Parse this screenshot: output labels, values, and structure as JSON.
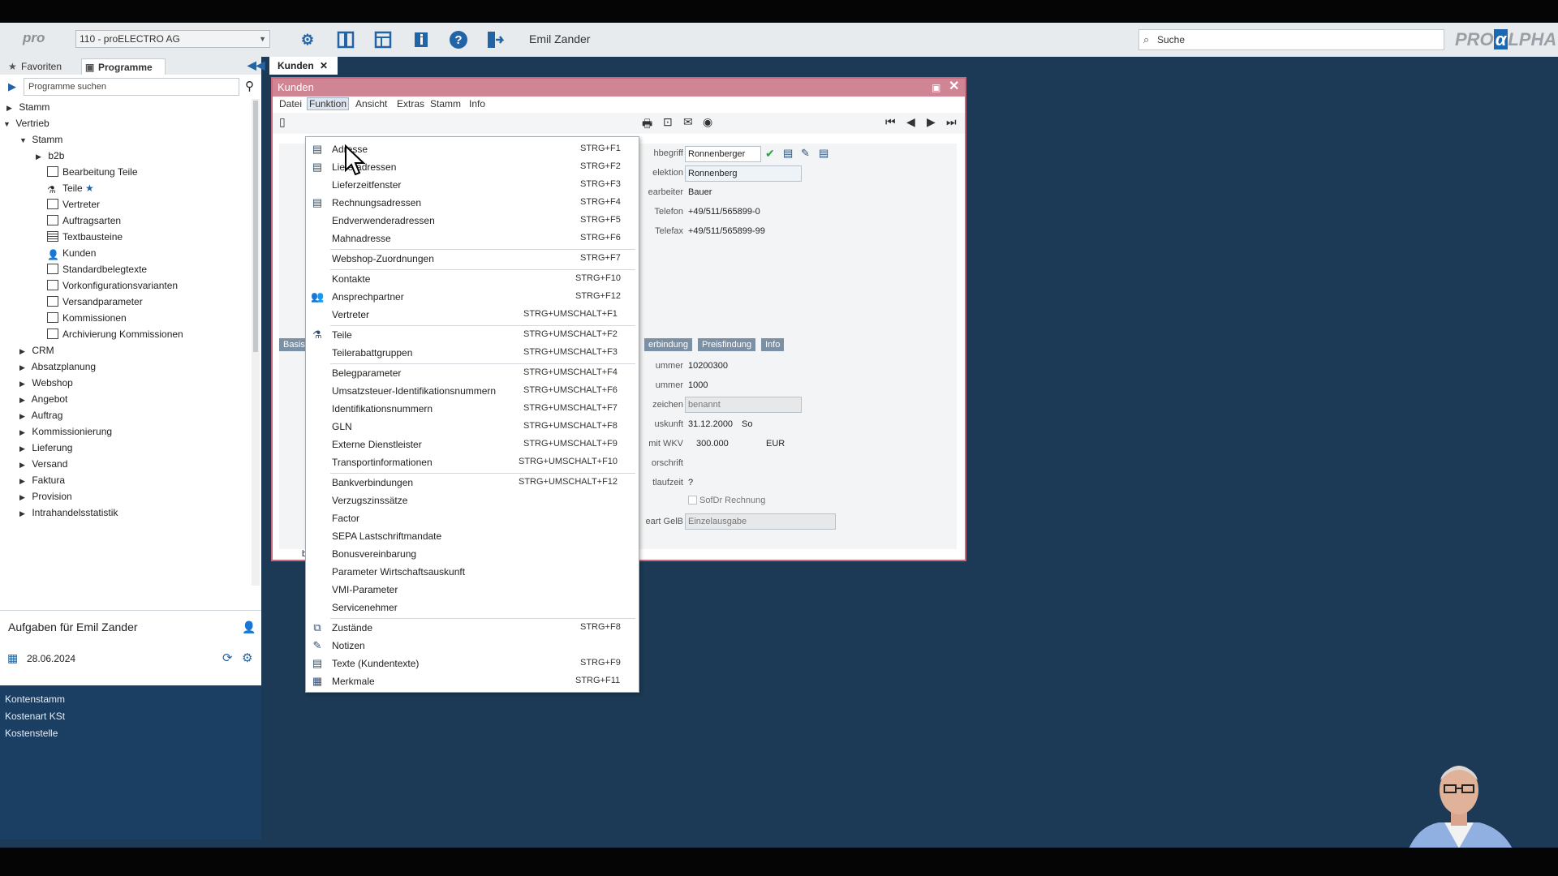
{
  "header": {
    "logo_text": "pro",
    "client": "110 - proELECTRO AG",
    "user": "Emil Zander",
    "search_placeholder": "Suche",
    "brand_left": "PRO",
    "brand_alpha": "α",
    "brand_right": "LPHA"
  },
  "left_tabs": {
    "favorites": "Favoriten",
    "programs": "Programme"
  },
  "sidebar": {
    "search_placeholder": "Programme suchen",
    "tree": [
      {
        "label": "Stamm"
      },
      {
        "label": "Vertrieb"
      },
      {
        "label": "Stamm"
      },
      {
        "label": "b2b"
      },
      {
        "label": "Bearbeitung Teile"
      },
      {
        "label": "Teile"
      },
      {
        "label": "Vertreter"
      },
      {
        "label": "Auftragsarten"
      },
      {
        "label": "Textbausteine"
      },
      {
        "label": "Kunden"
      },
      {
        "label": "Standardbelegtexte"
      },
      {
        "label": "Vorkonfigurationsvarianten"
      },
      {
        "label": "Versandparameter"
      },
      {
        "label": "Kommissionen"
      },
      {
        "label": "Archivierung Kommissionen"
      },
      {
        "label": "CRM"
      },
      {
        "label": "Absatzplanung"
      },
      {
        "label": "Webshop"
      },
      {
        "label": "Angebot"
      },
      {
        "label": "Auftrag"
      },
      {
        "label": "Kommissionierung"
      },
      {
        "label": "Lieferung"
      },
      {
        "label": "Versand"
      },
      {
        "label": "Faktura"
      },
      {
        "label": "Provision"
      },
      {
        "label": "Intrahandelsstatistik"
      }
    ]
  },
  "tasks": {
    "title": "Aufgaben für Emil Zander",
    "date": "28.06.2024",
    "items": [
      "Kontenstamm",
      "Kostenart KSt",
      "Kostenstelle"
    ]
  },
  "doc_tab": {
    "label": "Kunden"
  },
  "window": {
    "title": "Kunden",
    "menus": [
      "Datei",
      "Funktion",
      "Ansicht",
      "Extras",
      "Stamm",
      "Info"
    ]
  },
  "form": {
    "labels": [
      "hbegriff",
      "elektion",
      "earbeiter",
      "Telefon",
      "Telefax",
      "ummer",
      "ummer",
      "zeichen",
      "uskunft",
      "mit WKV",
      "orschrift",
      "tlaufzeit",
      "eart GelB"
    ],
    "suchbegriff": "Ronnenberger",
    "selektion": "Ronnenberg",
    "bearbeiter": "Bauer",
    "telefon": "+49/511/565899-0",
    "telefax": "+49/511/565899-99",
    "tabs": [
      "Basis",
      "erbindung",
      "Preisfindung",
      "Info"
    ],
    "nummer1": "10200300",
    "nummer2": "1000",
    "kennzeichen": "benannt",
    "auskunft_date": "31.12.2000",
    "auskunft_day": "So",
    "wkv_amount": "300.000",
    "wkv_currency": "EUR",
    "laufzeit": "?",
    "sofort_rechnung": "SofDr Rechnung",
    "ausgabe": "Einzelausgabe",
    "side_letter": "b"
  },
  "menu": {
    "items": [
      {
        "label": "Adresse",
        "key": "STRG+F1"
      },
      {
        "label": "Lieferadressen",
        "key": "STRG+F2"
      },
      {
        "label": "Lieferzeitfenster",
        "key": "STRG+F3"
      },
      {
        "label": "Rechnungsadressen",
        "key": "STRG+F4"
      },
      {
        "label": "Endverwenderadressen",
        "key": "STRG+F5"
      },
      {
        "label": "Mahnadresse",
        "key": "STRG+F6"
      },
      {
        "label": "Webshop-Zuordnungen",
        "key": "STRG+F7"
      },
      {
        "label": "Kontakte",
        "key": "STRG+F10"
      },
      {
        "label": "Ansprechpartner",
        "key": "STRG+F12"
      },
      {
        "label": "Vertreter",
        "key": "STRG+UMSCHALT+F1"
      },
      {
        "label": "Teile",
        "key": "STRG+UMSCHALT+F2"
      },
      {
        "label": "Teilerabattgruppen",
        "key": "STRG+UMSCHALT+F3"
      },
      {
        "label": "Belegparameter",
        "key": "STRG+UMSCHALT+F4"
      },
      {
        "label": "Umsatzsteuer-Identifikationsnummern",
        "key": "STRG+UMSCHALT+F6"
      },
      {
        "label": "Identifikationsnummern",
        "key": "STRG+UMSCHALT+F7"
      },
      {
        "label": "GLN",
        "key": "STRG+UMSCHALT+F8"
      },
      {
        "label": "Externe Dienstleister",
        "key": "STRG+UMSCHALT+F9"
      },
      {
        "label": "Transportinformationen",
        "key": "STRG+UMSCHALT+F10"
      },
      {
        "label": "Bankverbindungen",
        "key": "STRG+UMSCHALT+F12"
      },
      {
        "label": "Verzugszinssätze",
        "key": ""
      },
      {
        "label": "Factor",
        "key": ""
      },
      {
        "label": "SEPA Lastschriftmandate",
        "key": ""
      },
      {
        "label": "Bonusvereinbarung",
        "key": ""
      },
      {
        "label": "Parameter Wirtschaftsauskunft",
        "key": ""
      },
      {
        "label": "VMI-Parameter",
        "key": ""
      },
      {
        "label": "Servicenehmer",
        "key": ""
      },
      {
        "label": "Zustände",
        "key": "STRG+F8"
      },
      {
        "label": "Notizen",
        "key": ""
      },
      {
        "label": "Texte (Kundentexte)",
        "key": "STRG+F9"
      },
      {
        "label": "Merkmale",
        "key": "STRG+F11"
      }
    ]
  },
  "colors": {
    "accent": "#2265a6",
    "window_title": "#cf8593",
    "background": "#1c3a55"
  }
}
